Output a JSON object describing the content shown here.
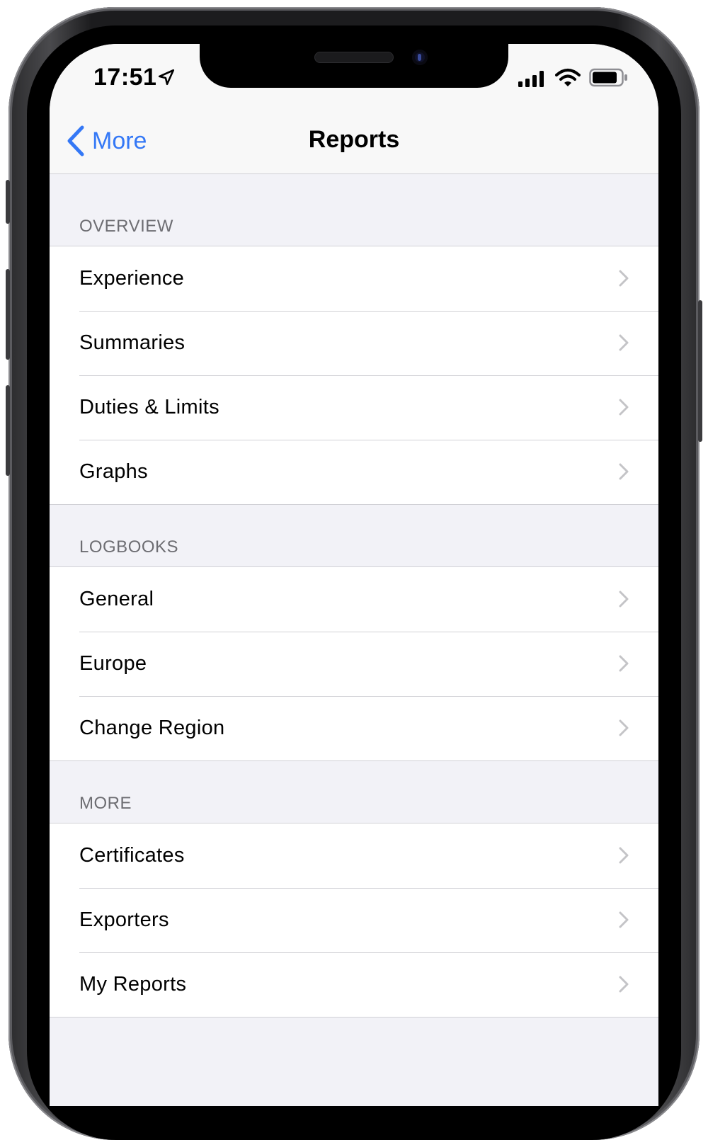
{
  "status_bar": {
    "time": "17:51",
    "icons": [
      "location-arrow-icon",
      "cellular-signal-icon",
      "wifi-icon",
      "battery-icon"
    ]
  },
  "nav": {
    "back_label": "More",
    "title": "Reports"
  },
  "colors": {
    "accent": "#3478f6",
    "background": "#f2f2f7",
    "section_header_text": "#6d6d72",
    "chevron": "#c4c4c7"
  },
  "sections": [
    {
      "header": "OVERVIEW",
      "items": [
        {
          "label": "Experience"
        },
        {
          "label": "Summaries"
        },
        {
          "label": "Duties & Limits"
        },
        {
          "label": "Graphs"
        }
      ]
    },
    {
      "header": "LOGBOOKS",
      "items": [
        {
          "label": "General"
        },
        {
          "label": "Europe"
        },
        {
          "label": "Change Region"
        }
      ]
    },
    {
      "header": "MORE",
      "items": [
        {
          "label": "Certificates"
        },
        {
          "label": "Exporters"
        },
        {
          "label": "My Reports"
        }
      ]
    }
  ]
}
